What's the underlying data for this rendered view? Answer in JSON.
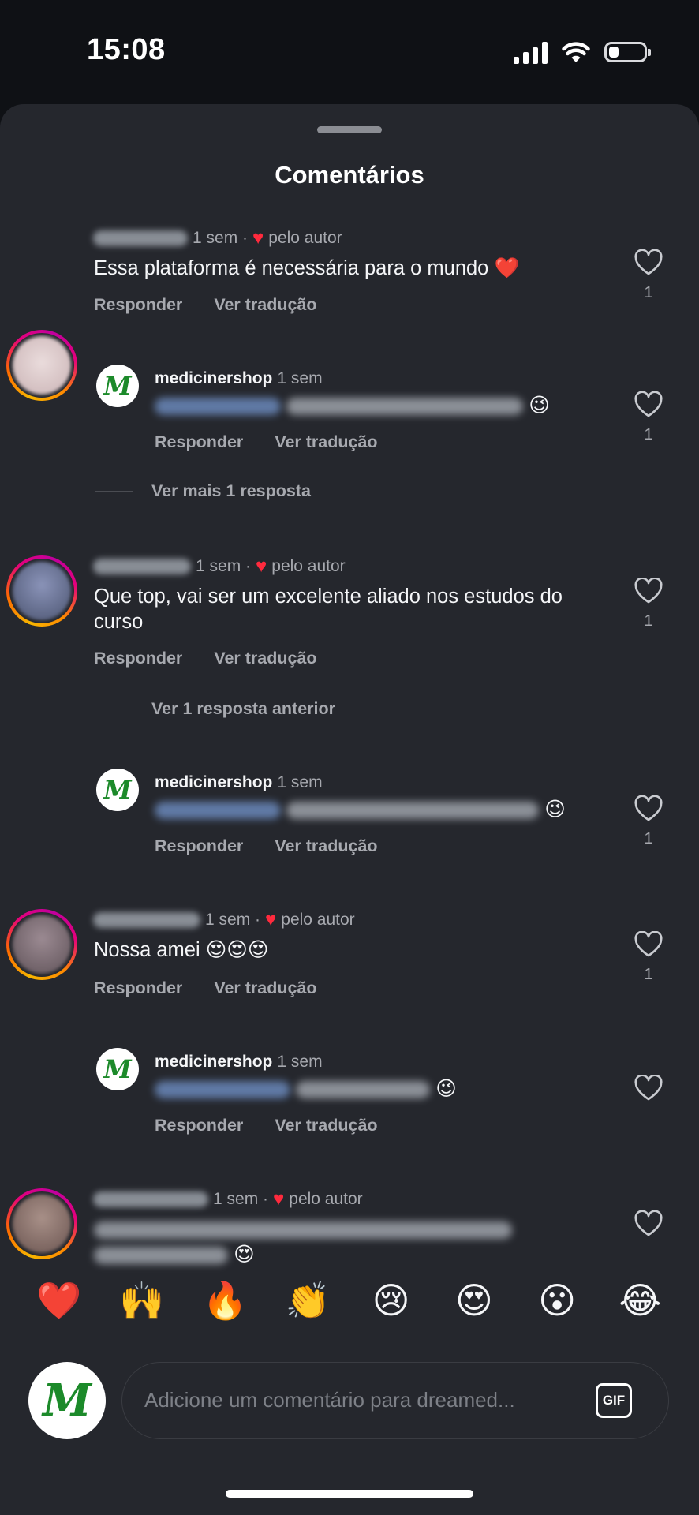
{
  "status_bar": {
    "time": "15:08"
  },
  "sheet": {
    "title": "Comentários"
  },
  "labels": {
    "reply": "Responder",
    "translate": "Ver tradução",
    "liked_by_author": "pelo autor"
  },
  "comments": [
    {
      "time": "1 sem ·",
      "text": "Essa plataforma é necessária para o mundo ❤️",
      "likes": "1"
    },
    {
      "user": "medicinershop",
      "time": "1 sem",
      "likes": "1"
    },
    {
      "more_replies": "Ver mais 1 resposta"
    },
    {
      "time": "1 sem ·",
      "text": "Que top, vai ser um excelente aliado nos estudos do curso",
      "likes": "1"
    },
    {
      "more_replies": "Ver 1 resposta anterior"
    },
    {
      "user": "medicinershop",
      "time": "1 sem",
      "likes": "1"
    },
    {
      "time": "1 sem ·",
      "text": "Nossa amei 😍😍😍",
      "likes": "1"
    },
    {
      "user": "medicinershop",
      "time": "1 sem"
    },
    {
      "time": "1 sem ·"
    }
  ],
  "reactions": [
    "❤️",
    "🙌",
    "🔥",
    "👏",
    "😢",
    "😍",
    "😮",
    "😂"
  ],
  "composer": {
    "placeholder": "Adicione um comentário para dreamed...",
    "gif_label": "GIF",
    "avatar_letter": "M"
  },
  "brand": {
    "avatar_letter": "M",
    "avatar_color": "#1c8a2a"
  },
  "icons": {
    "like": "heart-outline-icon",
    "author_like": "heart-filled-icon"
  }
}
